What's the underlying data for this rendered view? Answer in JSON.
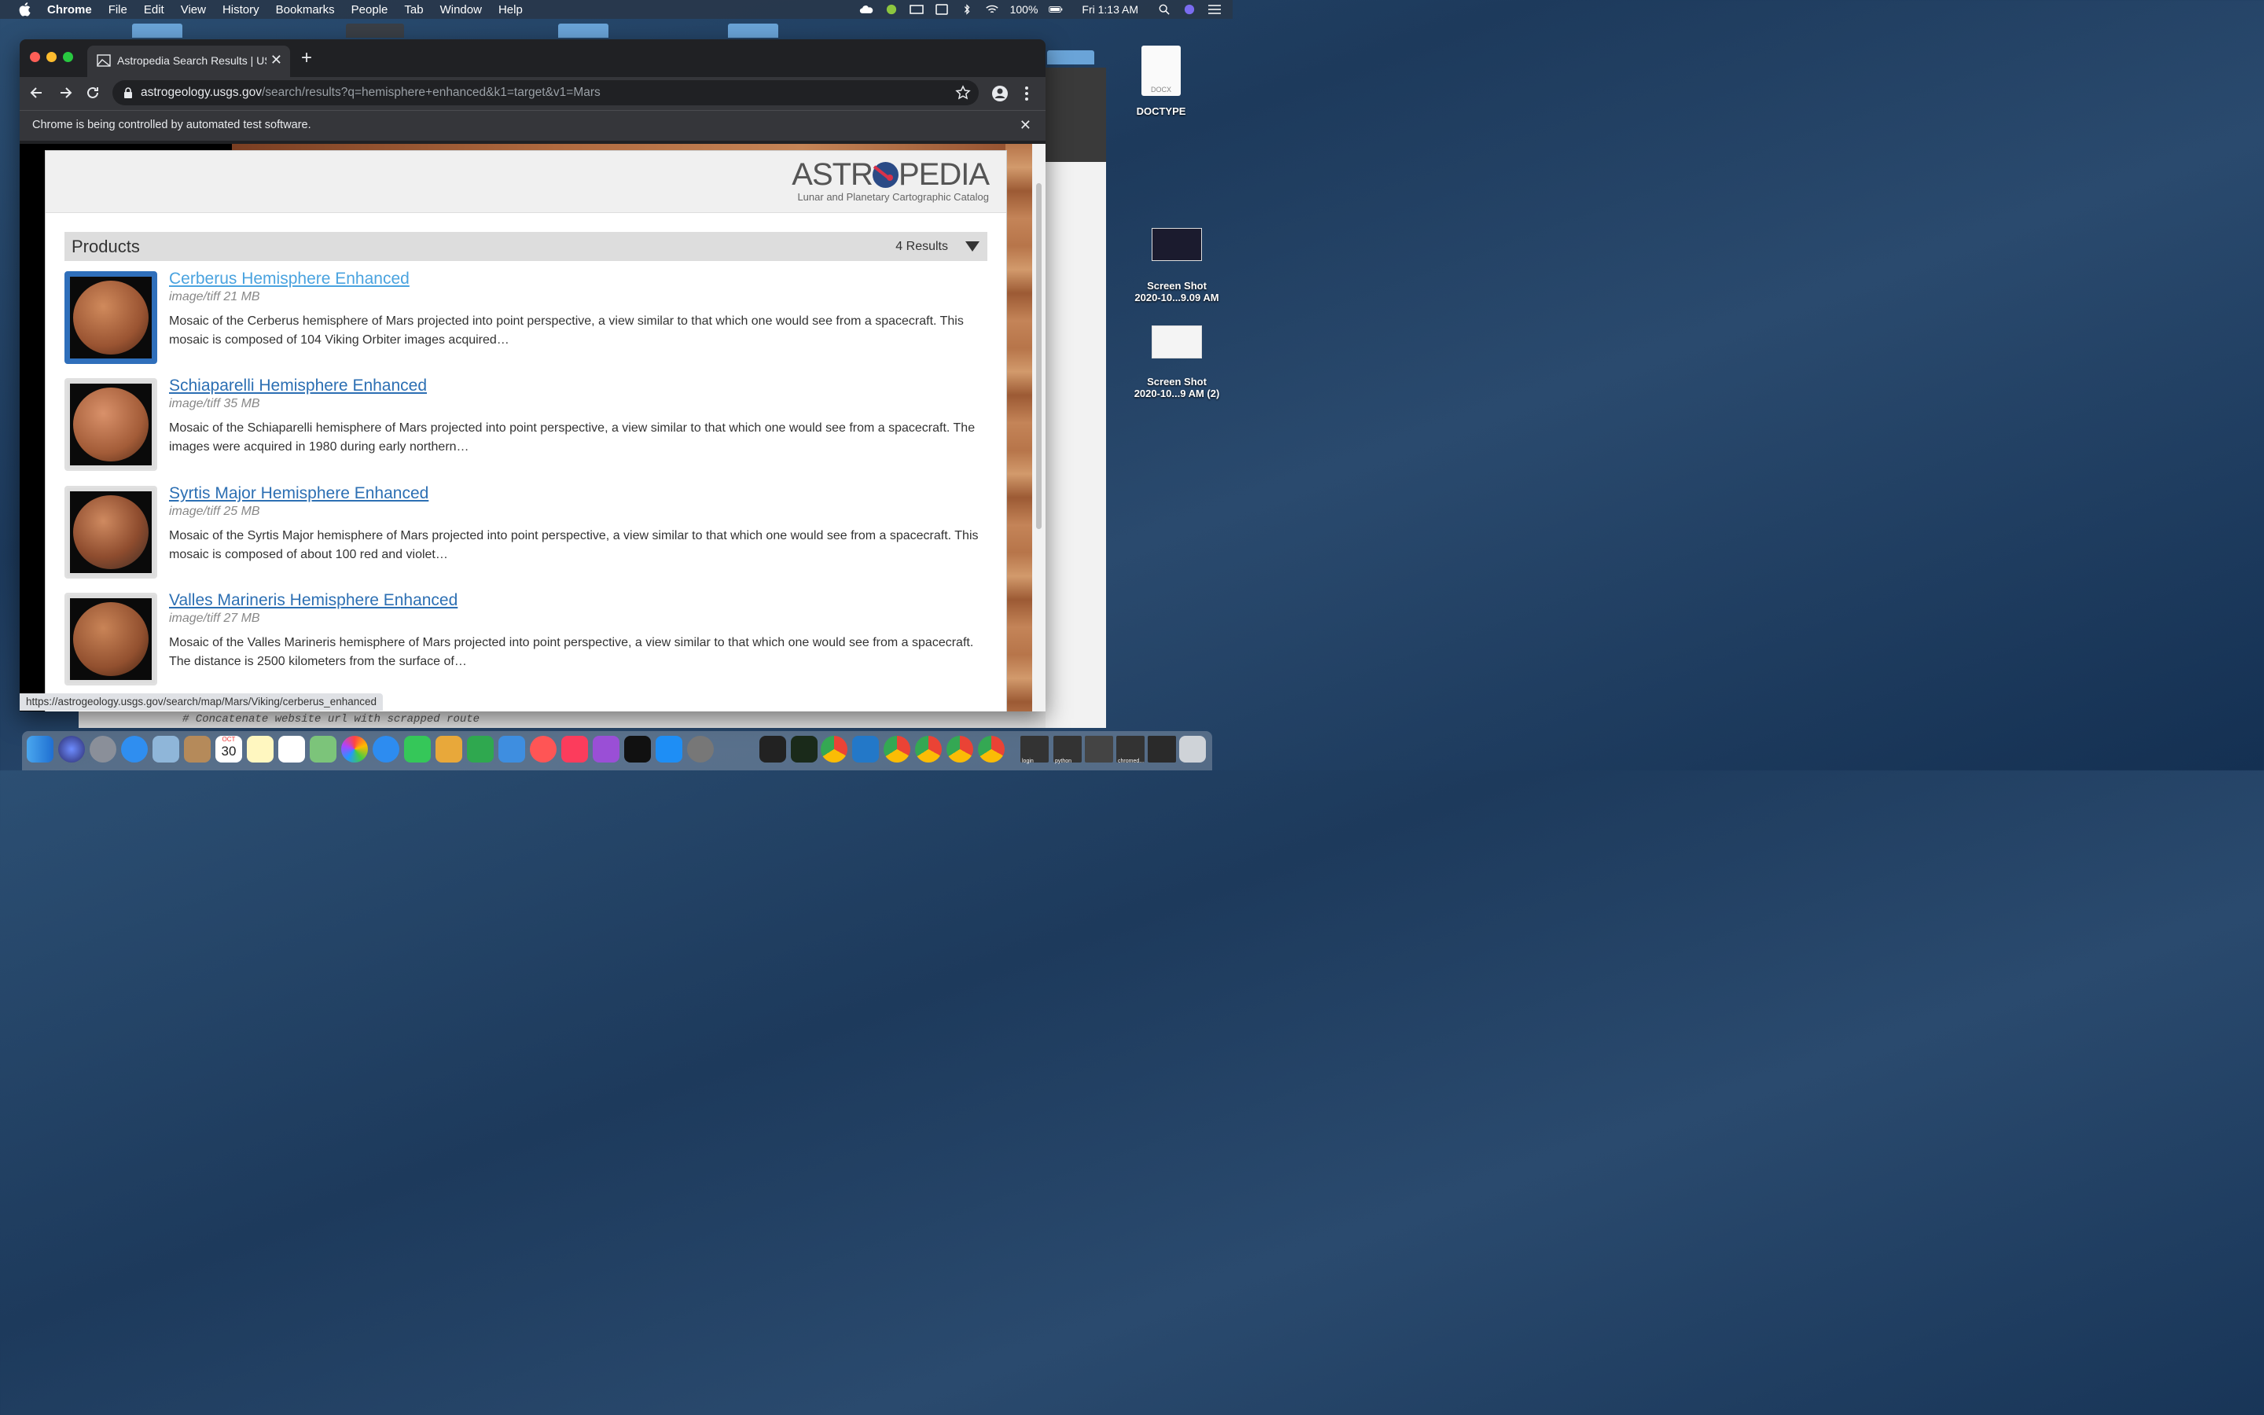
{
  "menubar": {
    "app": "Chrome",
    "items": [
      "File",
      "Edit",
      "View",
      "History",
      "Bookmarks",
      "People",
      "Tab",
      "Window",
      "Help"
    ],
    "battery": "100%",
    "clock": "Fri 1:13 AM"
  },
  "browser": {
    "tab_title": "Astropedia Search Results | USGS",
    "url_host": "astrogeology.usgs.gov",
    "url_path": "/search/results?q=hemisphere+enhanced&k1=target&v1=Mars",
    "infobar": "Chrome is being controlled by automated test software.",
    "status_url": "https://astrogeology.usgs.gov/search/map/Mars/Viking/cerberus_enhanced"
  },
  "page": {
    "logo_text_left": "ASTR",
    "logo_text_right": "PEDIA",
    "logo_tagline": "Lunar and Planetary Cartographic Catalog",
    "section_title": "Products",
    "result_count": "4 Results",
    "results": [
      {
        "title": "Cerberus Hemisphere Enhanced",
        "meta": "image/tiff 21 MB",
        "desc": "Mosaic of the Cerberus hemisphere of Mars projected into point perspective, a view similar to that which one would see from a spacecraft. This mosaic is composed of 104 Viking Orbiter images acquired…"
      },
      {
        "title": "Schiaparelli Hemisphere Enhanced",
        "meta": "image/tiff 35 MB",
        "desc": "Mosaic of the Schiaparelli hemisphere of Mars projected into point perspective, a view similar to that which one would see from a spacecraft. The images were acquired in 1980 during early northern…"
      },
      {
        "title": "Syrtis Major Hemisphere Enhanced",
        "meta": "image/tiff 25 MB",
        "desc": "Mosaic of the Syrtis Major hemisphere of Mars projected into point perspective, a view similar to that which one would see from a spacecraft. This mosaic is composed of about 100 red and violet…"
      },
      {
        "title": "Valles Marineris Hemisphere Enhanced",
        "meta": "image/tiff 27 MB",
        "desc": "Mosaic of the Valles Marineris hemisphere of Mars projected into point perspective, a view similar to that which one would see from a spacecraft. The distance is 2500 kilometers from the surface of…"
      }
    ]
  },
  "terminal_line": "# Concatenate website url with scrapped route",
  "desktop": {
    "docx_label": "DOCX",
    "docx_name": "DOCTYPE",
    "shot1_line1": "Screen Shot",
    "shot1_line2": "2020-10...9.09 AM",
    "shot2_line1": "Screen Shot",
    "shot2_line2": "2020-10...9 AM (2)"
  },
  "dock": {
    "calendar_month": "OCT",
    "calendar_day": "30",
    "label_login": "login",
    "label_python": "python",
    "label_chromed": "chromed..."
  },
  "colors": {
    "link": "#2c6fb3",
    "link_active": "#4aa3df",
    "chrome_dark": "#35363a"
  }
}
